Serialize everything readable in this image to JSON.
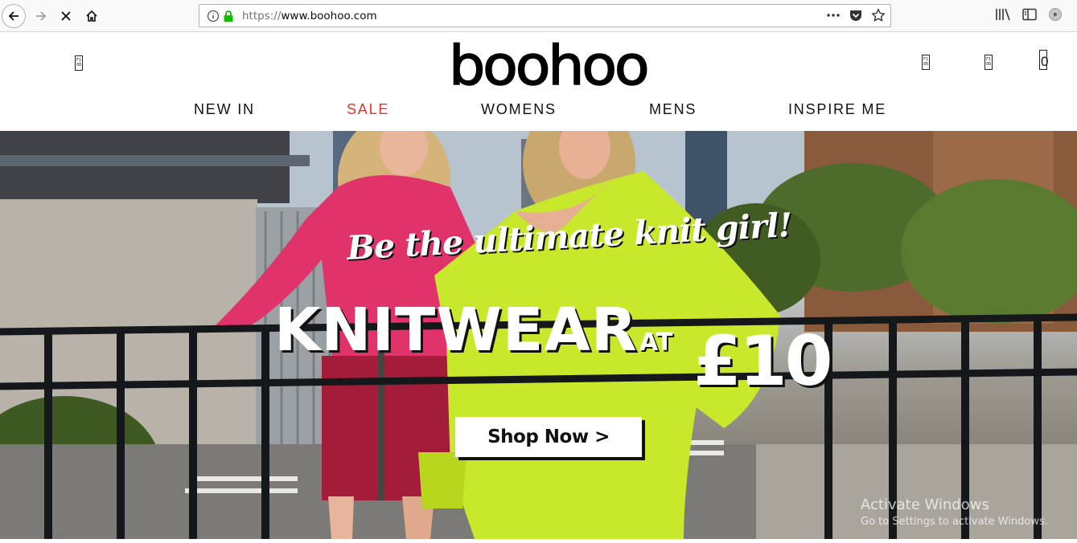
{
  "browser": {
    "url_scheme": "https://",
    "url_host": "www.boohoo.com"
  },
  "header": {
    "logo": "boohoo",
    "bag_count": "0",
    "placeholder_glyph": "F1\n08"
  },
  "nav": {
    "items": [
      {
        "label": "NEW IN"
      },
      {
        "label": "SALE"
      },
      {
        "label": "WOMENS"
      },
      {
        "label": "MENS"
      },
      {
        "label": "INSPIRE ME"
      }
    ],
    "sale_color": "#e3352c"
  },
  "hero": {
    "tagline": "Be the ultimate knit girl!",
    "headline": "KNITWEAR",
    "headline_at": "AT",
    "price": "£10",
    "cta_label": "Shop Now >"
  },
  "watermark": {
    "title": "Activate Windows",
    "subtitle": "Go to Settings to activate Windows."
  },
  "icons": {
    "back": "arrow-left-icon",
    "forward": "arrow-right-icon",
    "stop": "close-icon",
    "home": "home-icon",
    "info": "info-icon",
    "lock": "lock-icon",
    "more": "more-horizontal-icon",
    "pocket": "pocket-icon",
    "bookmark": "star-icon",
    "library": "library-icon",
    "sidebar": "sidebar-icon",
    "extension": "extension-icon"
  }
}
